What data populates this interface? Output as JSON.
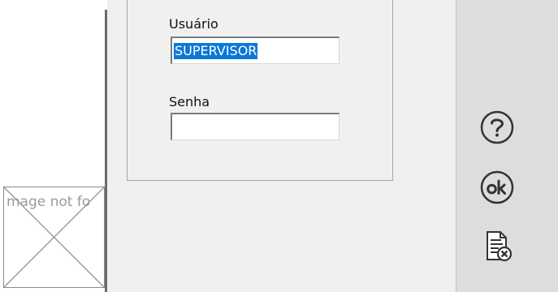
{
  "login": {
    "user_label": "Usuário",
    "user_value": "SUPERVISOR",
    "password_label": "Senha",
    "password_value": ""
  },
  "actions": [
    {
      "name": "help",
      "icon": "question-circle-icon"
    },
    {
      "name": "ok",
      "icon": "ok-circle-icon"
    },
    {
      "name": "cancel",
      "icon": "document-cancel-icon"
    }
  ],
  "image_placeholder": {
    "alt_text": "mage not fo"
  },
  "colors": {
    "dialog_bg": "#f0f0f0",
    "panel_bg": "#dddddd",
    "selection": "#0a78d7"
  }
}
